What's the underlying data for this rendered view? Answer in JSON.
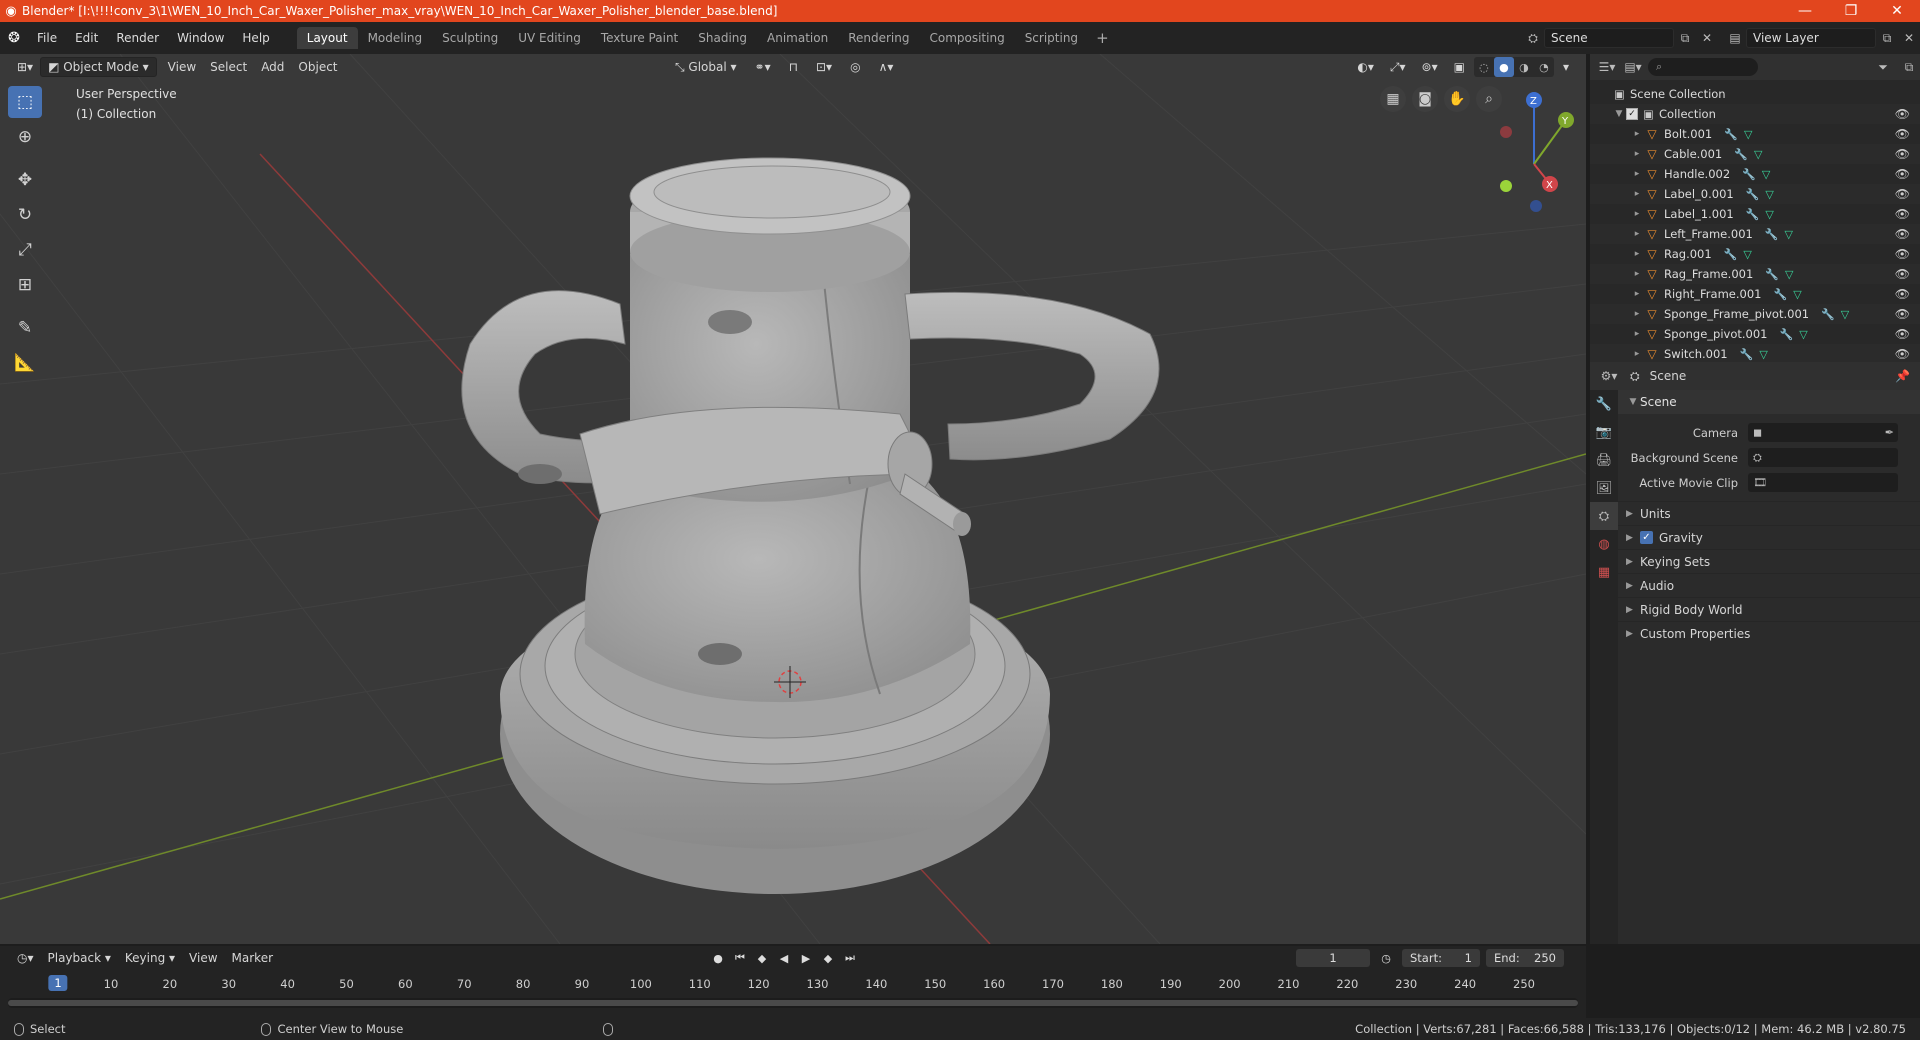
{
  "title_bar": {
    "text": "Blender* [I:\\!!!!conv_3\\1\\WEN_10_Inch_Car_Waxer_Polisher_max_vray\\WEN_10_Inch_Car_Waxer_Polisher_blender_base.blend]",
    "minimize": "—",
    "maximize": "❐",
    "close": "✕"
  },
  "menu": [
    "File",
    "Edit",
    "Render",
    "Window",
    "Help"
  ],
  "workspaces": [
    "Layout",
    "Modeling",
    "Sculpting",
    "UV Editing",
    "Texture Paint",
    "Shading",
    "Animation",
    "Rendering",
    "Compositing",
    "Scripting"
  ],
  "workspace_add": "+",
  "scene_field": "Scene",
  "view_layer_field": "View Layer",
  "viewport": {
    "mode": "Object Mode",
    "menus": [
      "View",
      "Select",
      "Add",
      "Object"
    ],
    "transform_orientation": "Global",
    "perspective": "User Perspective",
    "collection": "(1) Collection",
    "gizmo": {
      "x": "X",
      "y": "Y",
      "z": "Z"
    }
  },
  "outliner": {
    "root": "Scene Collection",
    "collection": "Collection",
    "items": [
      "Bolt.001",
      "Cable.001",
      "Handle.002",
      "Label_0.001",
      "Label_1.001",
      "Left_Frame.001",
      "Rag.001",
      "Rag_Frame.001",
      "Right_Frame.001",
      "Sponge_Frame_pivot.001",
      "Sponge_pivot.001",
      "Switch.001"
    ]
  },
  "properties": {
    "header": "Scene",
    "panel": "Scene",
    "rows": [
      {
        "label": "Camera"
      },
      {
        "label": "Background Scene"
      },
      {
        "label": "Active Movie Clip"
      }
    ],
    "subpanels": [
      "Units",
      "Gravity",
      "Keying Sets",
      "Audio",
      "Rigid Body World",
      "Custom Properties"
    ]
  },
  "timeline": {
    "menus": [
      "Playback",
      "Keying",
      "View",
      "Marker"
    ],
    "current_frame": "1",
    "start_label": "Start:",
    "start": "1",
    "end_label": "End:",
    "end": "250",
    "ticks": [
      "1",
      "10",
      "20",
      "30",
      "40",
      "50",
      "60",
      "70",
      "80",
      "90",
      "100",
      "110",
      "120",
      "130",
      "140",
      "150",
      "160",
      "170",
      "180",
      "190",
      "200",
      "210",
      "220",
      "230",
      "240",
      "250"
    ]
  },
  "statusbar": {
    "left": "Select",
    "middle": "Center View to Mouse",
    "stats": "Collection | Verts:67,281 | Faces:66,588 | Tris:133,176 | Objects:0/12 | Mem: 46.2 MB | v2.80.75"
  }
}
